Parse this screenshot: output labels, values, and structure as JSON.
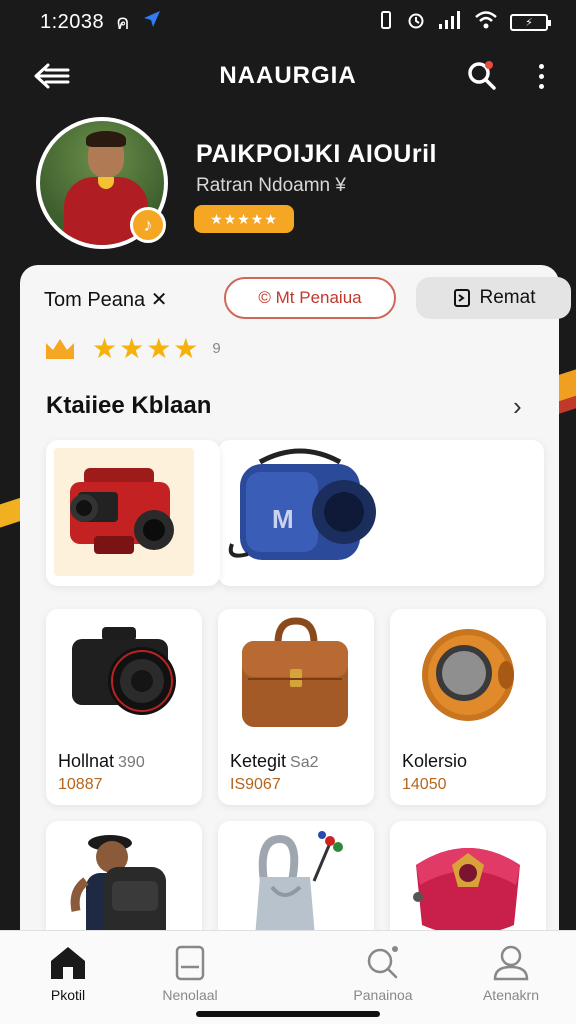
{
  "status_bar": {
    "time": "1:2038",
    "carrier_glyph": "ค",
    "icons": [
      "location-arrow-icon",
      "vibrate-icon",
      "alarm-icon",
      "signal-icon",
      "wifi-icon",
      "battery-icon"
    ],
    "battery_label": "⚡"
  },
  "app_bar": {
    "title": "NAAURGIA"
  },
  "profile": {
    "name": "PAIKPOIJKI AIOUril",
    "subtitle": "Ratran Ndoamn ¥",
    "rating_stars": "★★★★★"
  },
  "seller_row": {
    "name": "Tom Peana ✕",
    "outline_button": "© Mt Penaiua",
    "grey_button": "Remat"
  },
  "rating": {
    "stars": "★★★★",
    "count": "9"
  },
  "section": {
    "title": "Ktaiiee Kblaan",
    "more": "›"
  },
  "products": [
    {
      "title": "Hollnat",
      "sub": "390",
      "price": "10887"
    },
    {
      "title": "Ketegit",
      "sub": "Sa2",
      "price": "IS9067"
    },
    {
      "title": "Kolersio",
      "sub": "",
      "price": "14050"
    },
    {
      "title": "",
      "sub": "",
      "price": ""
    },
    {
      "title": "",
      "sub": "",
      "price": ""
    },
    {
      "title": "",
      "sub": "",
      "price": ""
    }
  ],
  "bottom_nav": [
    {
      "label": "Pkotil",
      "icon": "home-icon",
      "active": true
    },
    {
      "label": "Nenolaal",
      "icon": "tablet-icon",
      "active": false
    },
    {
      "label": "Panainoa",
      "icon": "search-icon",
      "active": false
    },
    {
      "label": "Atenakrn",
      "icon": "user-icon",
      "active": false
    }
  ],
  "colors": {
    "background": "#1a1a1a",
    "accent": "#f5a623",
    "danger": "#c0392b",
    "sheet": "#f6f6f6"
  }
}
